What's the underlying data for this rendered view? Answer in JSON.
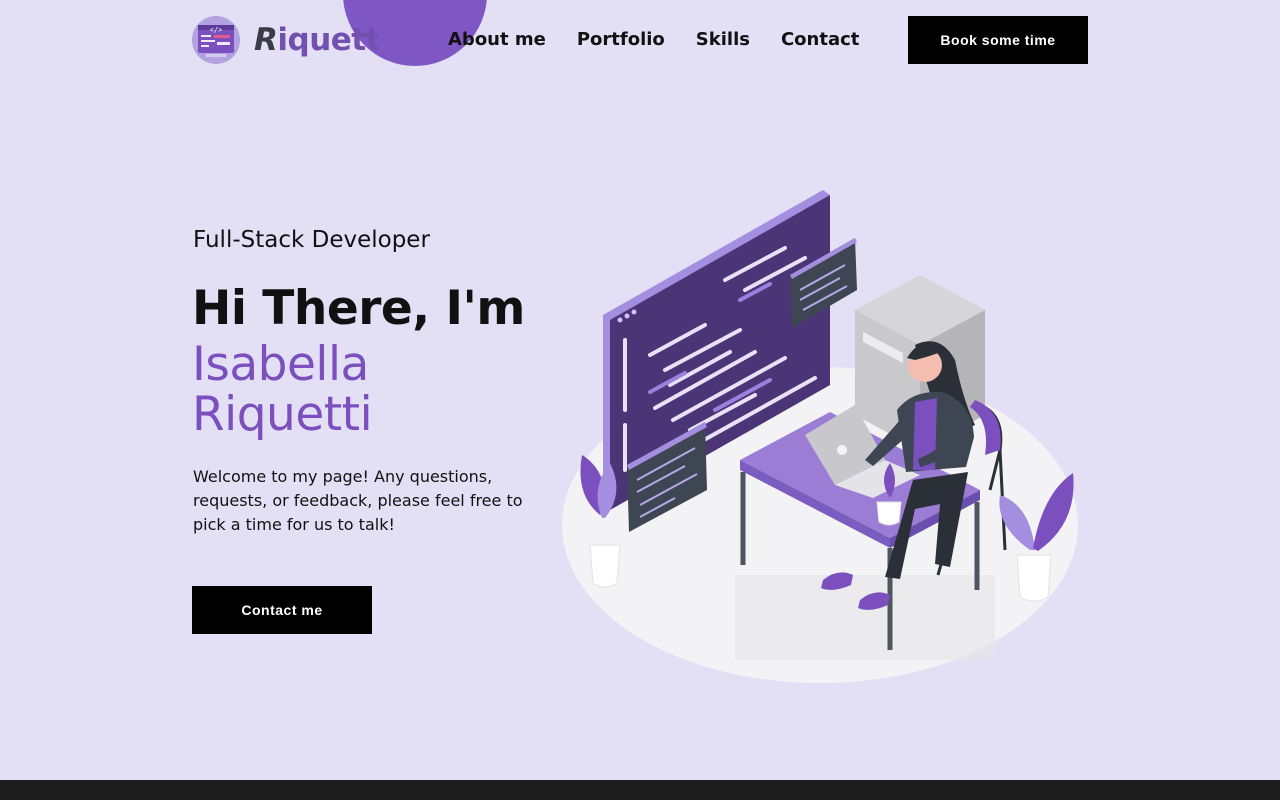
{
  "logo": {
    "first_letter": "R",
    "rest": "iquetti",
    "icon": "code-window-icon"
  },
  "nav": {
    "items": [
      {
        "label": "About me"
      },
      {
        "label": "Portfolio"
      },
      {
        "label": "Skills"
      },
      {
        "label": "Contact"
      }
    ],
    "cta_label": "Book some time"
  },
  "hero": {
    "subtitle": "Full-Stack Developer",
    "greeting_bold": "Hi There",
    "greeting_rest": ", I'm",
    "name_first": "Isabella",
    "name_last": "Riquetti",
    "description": "Welcome to my page! Any questions, requests, or feedback, please feel free to pick a time for us to talk!",
    "cta_label": "Contact me",
    "illustration": "developer-at-desk-illustration"
  },
  "colors": {
    "background": "#e3dff5",
    "accent": "#7b4fbd",
    "button": "#000000",
    "footer": "#1d1d1d"
  }
}
